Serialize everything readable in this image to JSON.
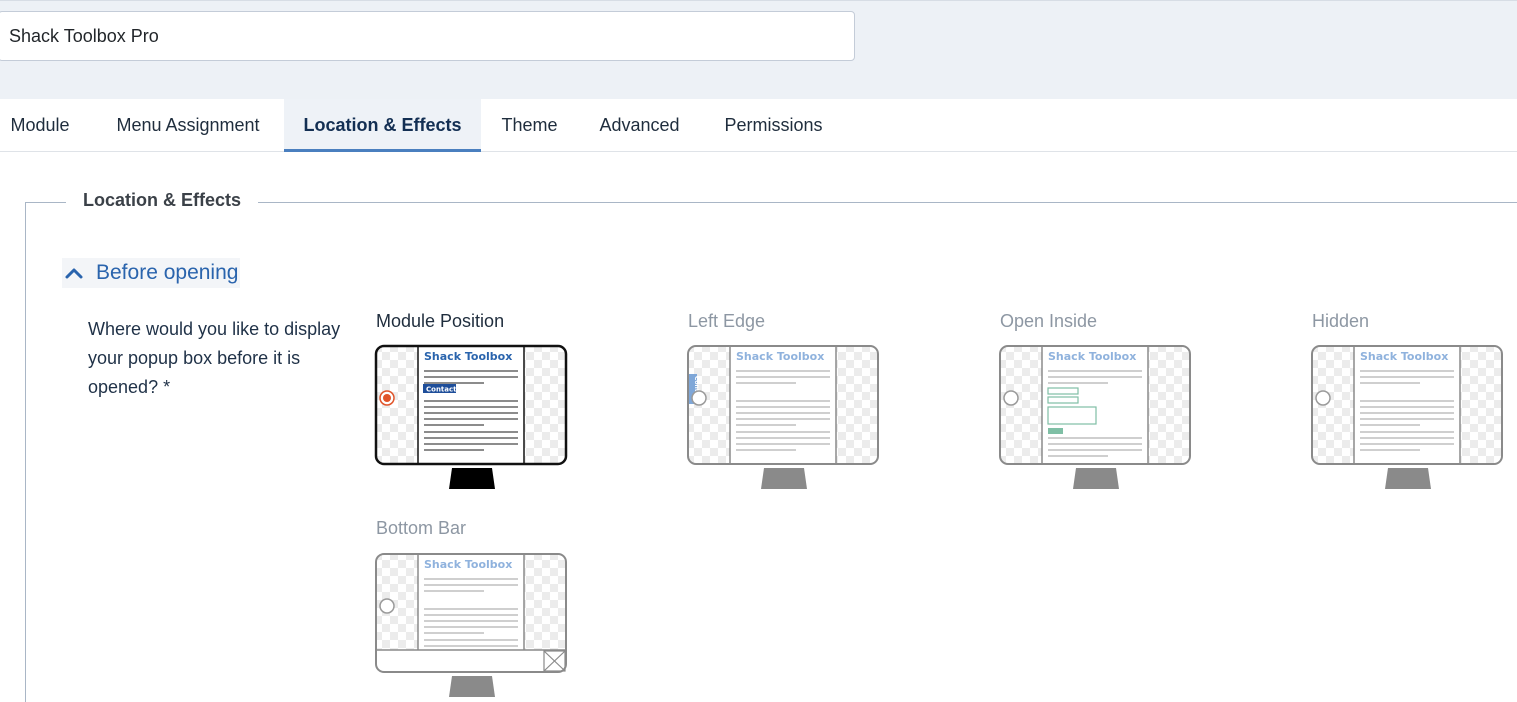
{
  "header": {
    "module_title": "Shack Toolbox Pro"
  },
  "tabs": [
    {
      "label": "Module"
    },
    {
      "label": "Menu Assignment"
    },
    {
      "label": "Location & Effects",
      "active": true
    },
    {
      "label": "Theme"
    },
    {
      "label": "Advanced"
    },
    {
      "label": "Permissions"
    }
  ],
  "fieldset": {
    "legend": "Location & Effects"
  },
  "accordion": {
    "label": "Before opening",
    "expanded": true,
    "icon": "chevron-up-icon"
  },
  "question": "Where would you like to display your popup box before it is opened? *",
  "options": [
    {
      "label": "Module Position",
      "selected": true
    },
    {
      "label": "Left Edge",
      "selected": false
    },
    {
      "label": "Open Inside",
      "selected": false
    },
    {
      "label": "Hidden",
      "selected": false
    },
    {
      "label": "Bottom Bar",
      "selected": false
    }
  ],
  "preview": {
    "heading": "Shack Toolbox",
    "button_label": "Contact"
  },
  "colors": {
    "accent": "#2a64ad",
    "radio_selected": "#e0542a",
    "tab_underline": "#4a7fbf",
    "form_green": "#7fbfa5"
  }
}
